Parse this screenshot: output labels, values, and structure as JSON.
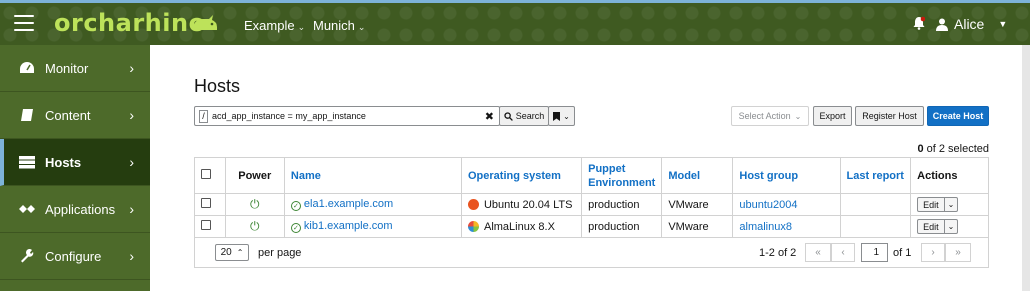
{
  "brand": {
    "name": "orcharhino",
    "accent": "#bde25a"
  },
  "topbar": {
    "organization": "Example",
    "location": "Munich",
    "user": "Alice",
    "icons": [
      "menu-icon",
      "bell-icon",
      "user-icon",
      "caret-down-icon"
    ]
  },
  "sidebar": {
    "items": [
      {
        "label": "Monitor",
        "icon": "dashboard-icon",
        "active": false
      },
      {
        "label": "Content",
        "icon": "book-icon",
        "active": false
      },
      {
        "label": "Hosts",
        "icon": "server-icon",
        "active": true
      },
      {
        "label": "Applications",
        "icon": "applications-icon",
        "active": false
      },
      {
        "label": "Configure",
        "icon": "wrench-icon",
        "active": false
      }
    ]
  },
  "page": {
    "title": "Hosts",
    "search_value": "acd_app_instance = my_app_instance",
    "search_button": "Search",
    "select_action": "Select Action",
    "export": "Export",
    "register_host": "Register Host",
    "create_host": "Create Host",
    "selected_num": "0",
    "selected_rest": " of 2 selected"
  },
  "table": {
    "headers": {
      "power": "Power",
      "name": "Name",
      "os": "Operating system",
      "puppet_env": "Puppet Environment",
      "model": "Model",
      "host_group": "Host group",
      "last_report": "Last report",
      "actions": "Actions"
    },
    "rows": [
      {
        "name": "ela1.example.com",
        "os": "Ubuntu 20.04 LTS",
        "puppet_env": "production",
        "model": "VMware",
        "host_group": "ubuntu2004",
        "last_report": "",
        "action": "Edit"
      },
      {
        "name": "kib1.example.com",
        "os": "AlmaLinux 8.X",
        "puppet_env": "production",
        "model": "VMware",
        "host_group": "almalinux8",
        "last_report": "",
        "action": "Edit"
      }
    ]
  },
  "pagination": {
    "per_page_value": "20",
    "per_page_label": "per page",
    "range_text": "1-2 of 2",
    "page_value": "1",
    "of_pages": "of 1"
  },
  "colors": {
    "topbar": "#3f5a21",
    "sidebar": "#4d6a2a",
    "sidebar_active": "#253d0f",
    "primary": "#1270c5",
    "power_on": "#3e8635"
  }
}
